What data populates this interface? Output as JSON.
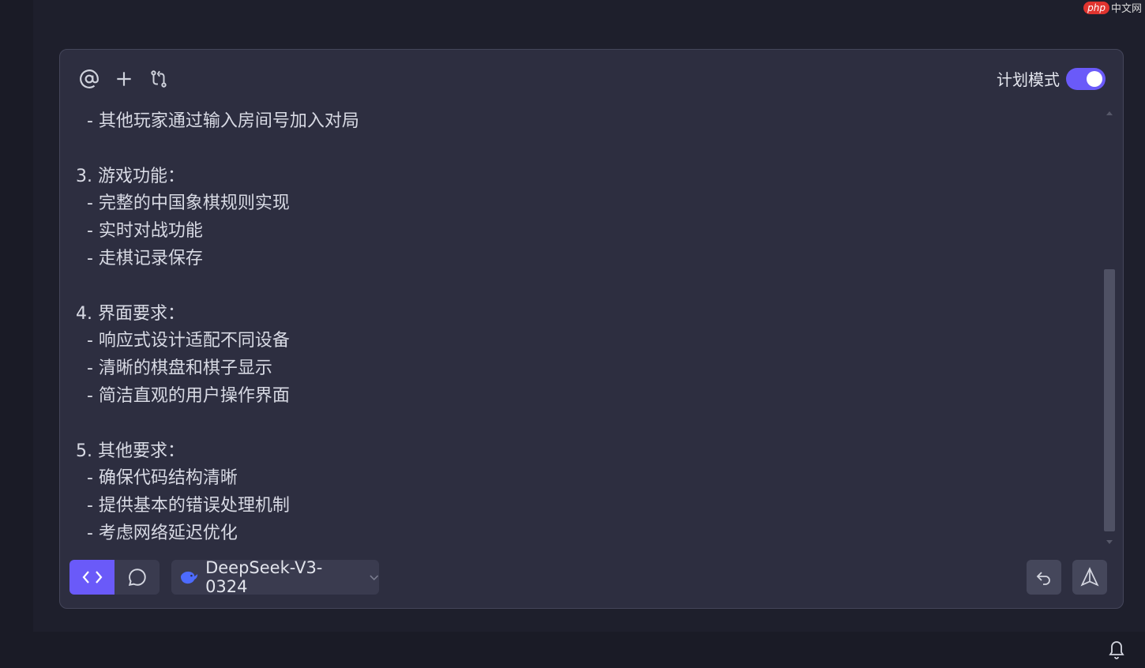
{
  "watermark": {
    "badge": "php",
    "text": "中文网"
  },
  "toolbar": {
    "icons": [
      "at-icon",
      "plus-icon",
      "branch-icon"
    ]
  },
  "plan_mode": {
    "label": "计划模式",
    "enabled": true
  },
  "message_lines": [
    "  - 其他玩家通过输入房间号加入对局",
    "",
    "3. 游戏功能：",
    "  - 完整的中国象棋规则实现",
    "  - 实时对战功能",
    "  - 走棋记录保存",
    "",
    "4. 界面要求：",
    "  - 响应式设计适配不同设备",
    "  - 清晰的棋盘和棋子显示",
    "  - 简洁直观的用户操作界面",
    "",
    "5. 其他要求：",
    "  - 确保代码结构清晰",
    "  - 提供基本的错误处理机制",
    "  - 考虑网络延迟优化"
  ],
  "mode_buttons": [
    {
      "icon": "code-icon",
      "active": true
    },
    {
      "icon": "chat-bubble-icon",
      "active": false
    }
  ],
  "model": {
    "name": "DeepSeek-V3-0324",
    "icon": "deepseek-whale-icon"
  },
  "actions": [
    "undo-icon",
    "send-icon"
  ],
  "status_bar": {
    "icon": "bell-icon"
  },
  "colors": {
    "accent": "#6a5af9",
    "panel": "#2d2e40",
    "background": "#1e1f2c"
  }
}
